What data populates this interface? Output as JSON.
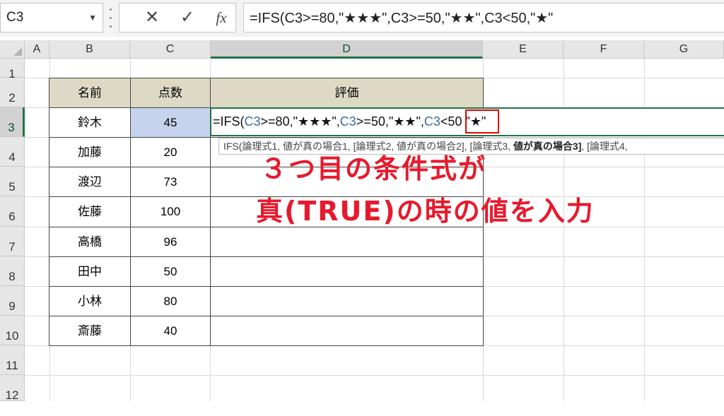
{
  "formula_bar": {
    "name_box": "C3",
    "cancel_icon": "✕",
    "enter_icon": "✓",
    "fx_label": "fx",
    "formula": "=IFS(C3>=80,\"★★★\",C3>=50,\"★★\",C3<50,\"★\""
  },
  "columns": [
    "A",
    "B",
    "C",
    "D",
    "E",
    "F",
    "G"
  ],
  "rows": [
    "1",
    "2",
    "3",
    "4",
    "5",
    "6",
    "7",
    "8",
    "9",
    "10",
    "11",
    "12"
  ],
  "table": {
    "headers": {
      "name": "名前",
      "score": "点数",
      "rating": "評価"
    },
    "records": [
      {
        "name": "鈴木",
        "score": "45"
      },
      {
        "name": "加藤",
        "score": "20"
      },
      {
        "name": "渡辺",
        "score": "73"
      },
      {
        "name": "佐藤",
        "score": "100"
      },
      {
        "name": "高橋",
        "score": "96"
      },
      {
        "name": "田中",
        "score": "50"
      },
      {
        "name": "小林",
        "score": "80"
      },
      {
        "name": "斎藤",
        "score": "40"
      }
    ]
  },
  "editing": {
    "p1": "=IFS(",
    "r1": "C3",
    "p2": ">=80,\"★★★\",",
    "r2": "C3",
    "p3": ">=50,\"★★\",",
    "r3": "C3",
    "p4": "<50 ",
    "p5": "\"★\""
  },
  "tooltip": {
    "t1": "IFS(論理式1, 値が真の場合1, [論理式2, 値が真の場合2], [論理式3, ",
    "bold": "値が真の場合3]",
    "t2": ", [論理式4, "
  },
  "callout": {
    "line1": "３つ目の条件式が",
    "line2": "真(TRUE)の時の値を入力"
  },
  "colors": {
    "header_fill": "#ddd9c4",
    "selected_fill": "#c5d4ec",
    "excel_green": "#217346",
    "callout_red": "#e8192c"
  }
}
